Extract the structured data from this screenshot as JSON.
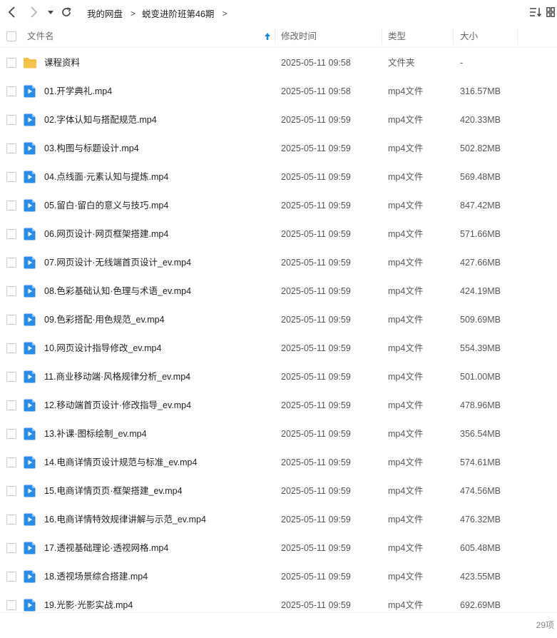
{
  "toolbar": {
    "breadcrumb": [
      "我的网盘",
      "蜕变进阶班第46期"
    ],
    "separator": ">"
  },
  "header": {
    "name": "文件名",
    "modified": "修改时间",
    "type": "类型",
    "size": "大小"
  },
  "files": [
    {
      "name": "课程资料",
      "date": "2025-05-11 09:58",
      "type": "文件夹",
      "size": "-",
      "icon": "folder"
    },
    {
      "name": "01.开学典礼.mp4",
      "date": "2025-05-11 09:58",
      "type": "mp4文件",
      "size": "316.57MB",
      "icon": "video"
    },
    {
      "name": "02.字体认知与搭配规范.mp4",
      "date": "2025-05-11 09:59",
      "type": "mp4文件",
      "size": "420.33MB",
      "icon": "video"
    },
    {
      "name": "03.构图与标题设计.mp4",
      "date": "2025-05-11 09:59",
      "type": "mp4文件",
      "size": "502.82MB",
      "icon": "video"
    },
    {
      "name": "04.点线面·元素认知与提炼.mp4",
      "date": "2025-05-11 09:59",
      "type": "mp4文件",
      "size": "569.48MB",
      "icon": "video"
    },
    {
      "name": "05.留白·留白的意义与技巧.mp4",
      "date": "2025-05-11 09:59",
      "type": "mp4文件",
      "size": "847.42MB",
      "icon": "video"
    },
    {
      "name": "06.网页设计·网页框架搭建.mp4",
      "date": "2025-05-11 09:59",
      "type": "mp4文件",
      "size": "571.66MB",
      "icon": "video"
    },
    {
      "name": "07.网页设计·无线端首页设计_ev.mp4",
      "date": "2025-05-11 09:59",
      "type": "mp4文件",
      "size": "427.66MB",
      "icon": "video"
    },
    {
      "name": "08.色彩基础认知·色理与术语_ev.mp4",
      "date": "2025-05-11 09:59",
      "type": "mp4文件",
      "size": "424.19MB",
      "icon": "video"
    },
    {
      "name": "09.色彩搭配·用色规范_ev.mp4",
      "date": "2025-05-11 09:59",
      "type": "mp4文件",
      "size": "509.69MB",
      "icon": "video"
    },
    {
      "name": "10.网页设计指导修改_ev.mp4",
      "date": "2025-05-11 09:59",
      "type": "mp4文件",
      "size": "554.39MB",
      "icon": "video"
    },
    {
      "name": "11.商业移动端·风格规律分析_ev.mp4",
      "date": "2025-05-11 09:59",
      "type": "mp4文件",
      "size": "501.00MB",
      "icon": "video"
    },
    {
      "name": "12.移动端首页设计·修改指导_ev.mp4",
      "date": "2025-05-11 09:59",
      "type": "mp4文件",
      "size": "478.96MB",
      "icon": "video"
    },
    {
      "name": "13.补课·图标绘制_ev.mp4",
      "date": "2025-05-11 09:59",
      "type": "mp4文件",
      "size": "356.54MB",
      "icon": "video"
    },
    {
      "name": "14.电商详情页设计规范与标准_ev.mp4",
      "date": "2025-05-11 09:59",
      "type": "mp4文件",
      "size": "574.61MB",
      "icon": "video"
    },
    {
      "name": "15.电商详情页页·框架搭建_ev.mp4",
      "date": "2025-05-11 09:59",
      "type": "mp4文件",
      "size": "474.56MB",
      "icon": "video"
    },
    {
      "name": "16.电商详情特效规律讲解与示范_ev.mp4",
      "date": "2025-05-11 09:59",
      "type": "mp4文件",
      "size": "476.32MB",
      "icon": "video"
    },
    {
      "name": "17.透视基础理论·透视网格.mp4",
      "date": "2025-05-11 09:59",
      "type": "mp4文件",
      "size": "605.48MB",
      "icon": "video"
    },
    {
      "name": "18.透视场景综合搭建.mp4",
      "date": "2025-05-11 09:59",
      "type": "mp4文件",
      "size": "423.55MB",
      "icon": "video"
    },
    {
      "name": "19.光影·光影实战.mp4",
      "date": "2025-05-11 09:59",
      "type": "mp4文件",
      "size": "692.69MB",
      "icon": "video"
    }
  ],
  "footer": {
    "count": "29项"
  },
  "colors": {
    "accent": "#1e88e5",
    "video_icon": "#2a8be8",
    "folder_icon": "#f7c34a"
  }
}
